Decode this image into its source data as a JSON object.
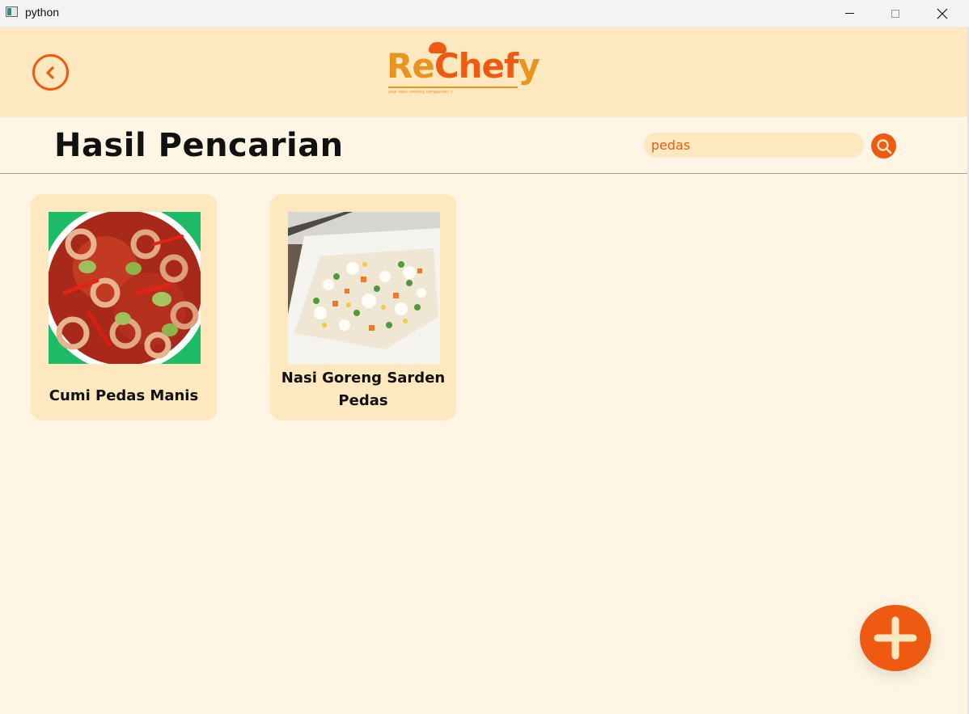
{
  "window": {
    "title": "python",
    "icon": "app-window-icon",
    "controls": [
      "minimize-icon",
      "maximize-icon",
      "close-icon"
    ]
  },
  "header": {
    "back_icon": "chevron-left-circle-icon",
    "logo": {
      "part1": "Re",
      "part2": "Chef",
      "part3": "y",
      "tagline": "your best cooking companion :)"
    }
  },
  "page": {
    "title": "Hasil Pencarian"
  },
  "search": {
    "value": "pedas",
    "icon": "search-icon"
  },
  "results": [
    {
      "title": "Cumi Pedas Manis",
      "image": "cumi-pedas-manis-photo"
    },
    {
      "title": "Nasi Goreng Sarden Pedas",
      "image": "nasi-goreng-photo"
    }
  ],
  "fab": {
    "icon": "plus-icon"
  },
  "colors": {
    "accent": "#ef5a12",
    "header_bg": "#fde8c0",
    "page_bg": "#fff5e4",
    "logo_secondary": "#e8951f"
  }
}
